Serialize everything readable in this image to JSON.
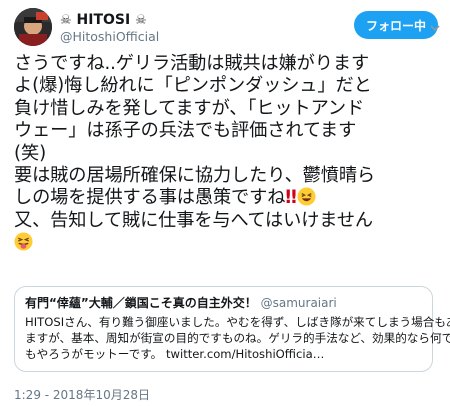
{
  "user": {
    "display_name": "HITOSI",
    "name_decoration": "☠",
    "handle": "@HitoshiOfficial"
  },
  "follow_button": {
    "label": "フォロー中"
  },
  "tweet": {
    "lines": [
      "さうですね..ゲリラ活動は賊共は嫌がります",
      "よ(爆)悔し紛れに「ピンポンダッシュ」だと",
      "負け惜しみを発してますが、「ヒットアンド",
      "ウェー」は孫子の兵法でも評価されてます",
      "(笑)",
      "要は賊の居場所確保に協力したり、鬱憤晴ら",
      "しの場を提供する事は愚策ですね",
      "又、告知して賊に仕事を与へてはいけません"
    ],
    "emoji": {
      "exclamation": "‼",
      "grin": "grinning-squinting-face",
      "tongue": "squinting-face-with-tongue"
    }
  },
  "quote": {
    "name": "有門“倖蘊”大輔／鎖国こそ真の自主外交！",
    "handle": "@samuraiari",
    "lines": [
      "HITOSIさん、有り難う御座いました。やむを得ず、しばき隊が来てしまう場合もあり",
      "ますが、基本、周知が街宣の目的ですものね。ゲリラ的手法など、効果的なら何で",
      "もやろうがモットーです。 twitter.com/HitoshiOfficia…"
    ]
  },
  "timestamp": "1:29 - 2018年10月28日"
}
